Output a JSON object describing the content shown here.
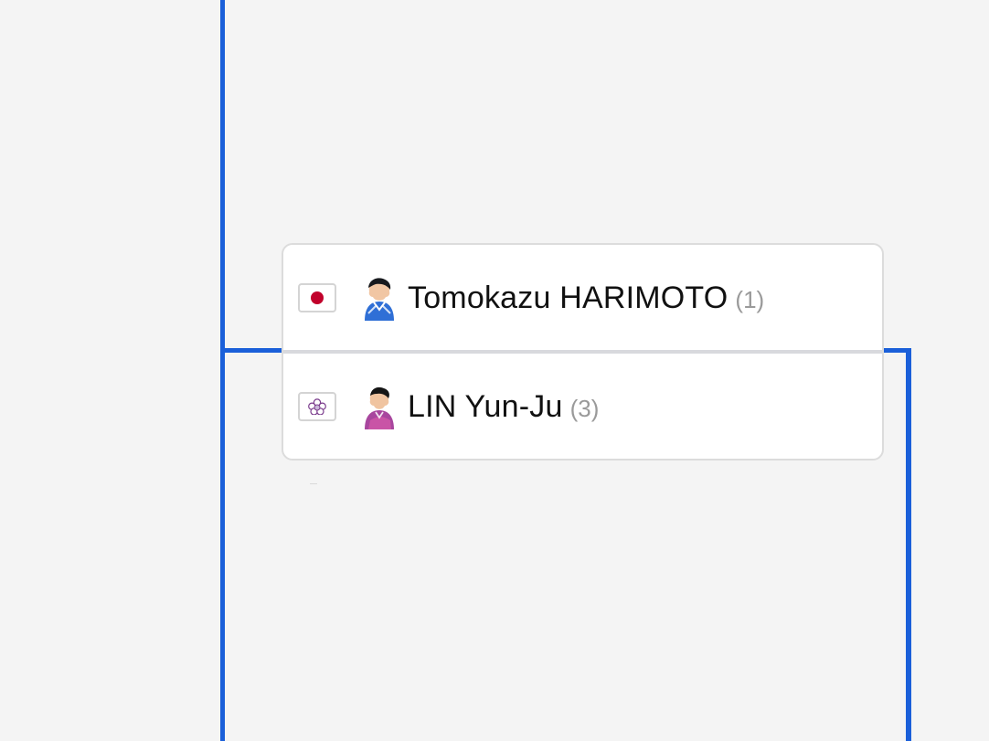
{
  "colors": {
    "background": "#f4f4f4",
    "bracket_line": "#1a5fd9",
    "card_border": "#dcdcdc",
    "seed_text": "#9a9a9a",
    "japan_red": "#c1002b"
  },
  "match": {
    "players": [
      {
        "flag_icon": "japan-flag-icon",
        "avatar_icon": "player-avatar-icon",
        "name": "Tomokazu HARIMOTO",
        "seed": "(1)"
      },
      {
        "flag_icon": "chinese-taipei-flag-icon",
        "avatar_icon": "player-avatar-icon",
        "name": "LIN Yun-Ju",
        "seed": "(3)"
      }
    ]
  }
}
